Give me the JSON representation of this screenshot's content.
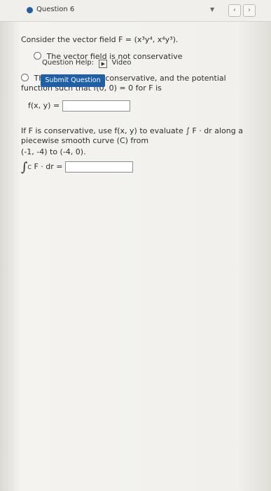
{
  "topbar": {
    "question_label": "Question 6",
    "dropdown_icon": "caret-down-icon",
    "prev_icon": "chevron-left-icon",
    "next_icon": "chevron-right-icon"
  },
  "problem": {
    "intro": "Consider the vector field F = (x³y⁴, x⁴y³).",
    "option_not_conservative": "The vector field is not conservative",
    "option_conservative": "The vector field is conservative, and the potential function such that f(0, 0) = 0 for F is",
    "fxy_label": "f(x, y) =",
    "evaluate_text": "If F is conservative, use f(x, y) to evaluate ∫ F · dr along a piecewise smooth curve (C) from",
    "curve_range": "(-1, -4) to (-4, 0).",
    "integral_label": "F · dr ="
  },
  "footer": {
    "help_label": "Question Help:",
    "video_label": "Video",
    "submit_label": "Submit Question"
  }
}
